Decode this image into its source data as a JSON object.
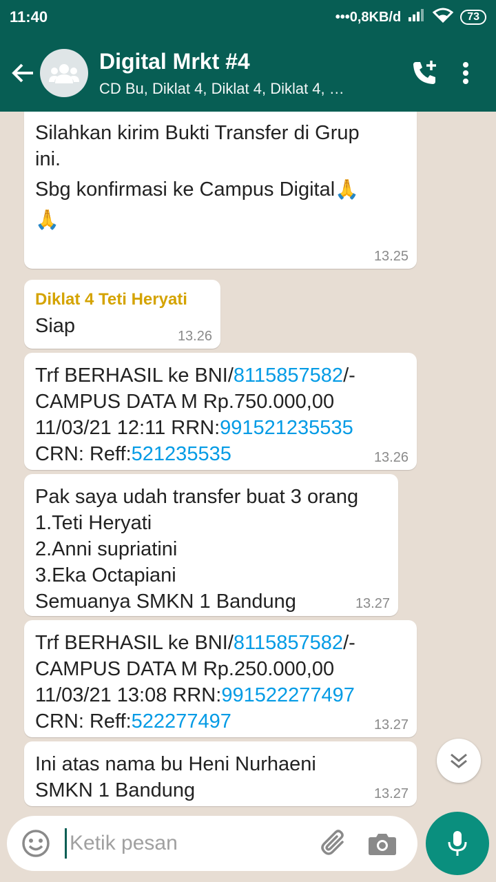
{
  "status": {
    "time": "11:40",
    "network": "•••0,8KB/d",
    "battery": "73"
  },
  "header": {
    "title": "Digital Mrkt #4",
    "members": "CD Bu, Diklat 4, Diklat 4, Diklat 4, …"
  },
  "messages": [
    {
      "line1": "Silahkan kirim Bukti Transfer di Grup",
      "line2": "ini.",
      "line3": "Sbg konfirmasi ke Campus Digital",
      "emoji": "🙏",
      "time": "13.25"
    },
    {
      "sender": "Diklat 4 Teti Heryati",
      "text": "Siap",
      "time": "13.26"
    },
    {
      "pre1": "Trf BERHASIL ke BNI/",
      "acct": "8115857582",
      "post1": "/-",
      "line2": "CAMPUS DATA M Rp.750.000,00",
      "pre3": "11/03/21 12:11 RRN:",
      "rrn": "991521235535",
      "pre4": "CRN: Reff:",
      "reff": "521235535",
      "time": "13.26"
    },
    {
      "line1": "Pak saya udah transfer buat 3 orang",
      "line2": "1.Teti Heryati",
      "line3": "2.Anni supriatini",
      "line4": "3.Eka Octapiani",
      "line5": "Semuanya SMKN 1 Bandung",
      "time": "13.27"
    },
    {
      "pre1": "Trf BERHASIL ke BNI/",
      "acct": "8115857582",
      "post1": "/-",
      "line2": "CAMPUS DATA M Rp.250.000,00",
      "pre3": "11/03/21 13:08 RRN:",
      "rrn": "991522277497",
      "pre4": "CRN: Reff:",
      "reff": "522277497",
      "time": "13.27"
    },
    {
      "line1": "Ini atas nama bu Heni Nurhaeni",
      "line2": "SMKN 1 Bandung",
      "time": "13.27"
    }
  ],
  "input": {
    "placeholder": "Ketik pesan"
  },
  "colors": {
    "header": "#075e54",
    "link": "#039be5",
    "sender": "#d4a300",
    "mic": "#0a8f7e"
  }
}
